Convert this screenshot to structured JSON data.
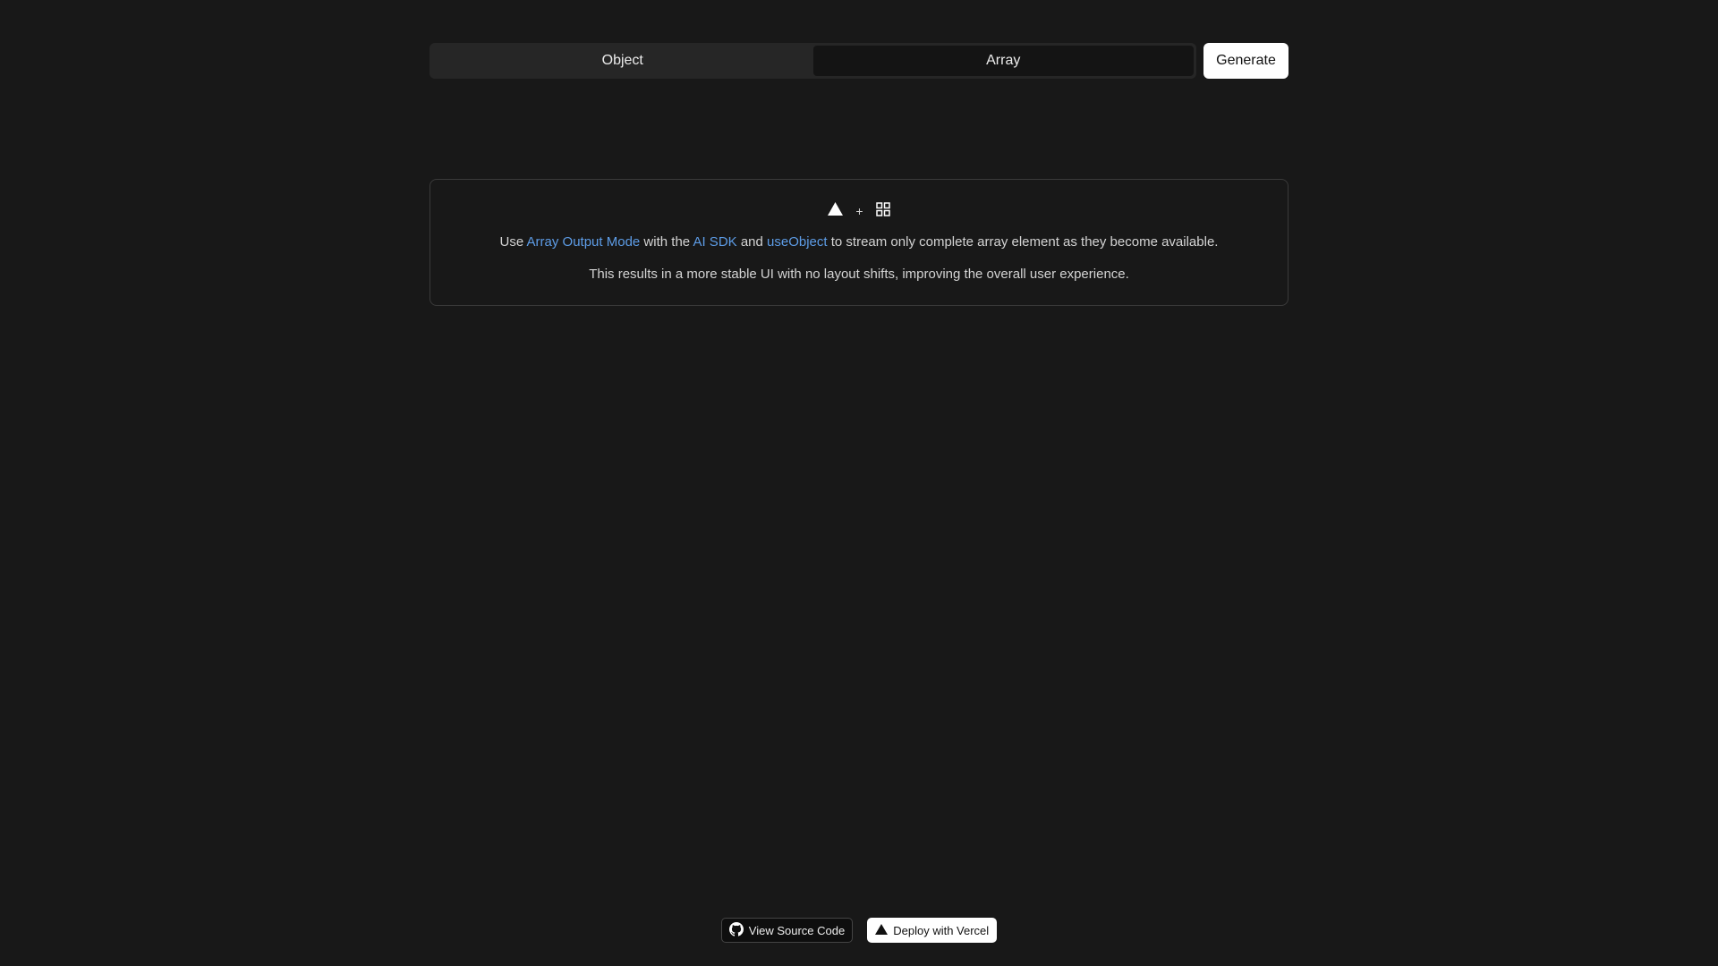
{
  "tabs": {
    "items": [
      {
        "label": "Object",
        "active": false
      },
      {
        "label": "Array",
        "active": true
      }
    ]
  },
  "toolbar": {
    "generate_label": "Generate"
  },
  "info": {
    "logos": [
      "vercel-triangle-icon",
      "plus",
      "grid-icon"
    ],
    "plus_label": "+",
    "line1": {
      "use": "Use ",
      "link_array_output": "Array Output Mode",
      "with_the": " with the ",
      "link_ai_sdk": "AI SDK",
      "and": " and ",
      "link_use_object": "useObject",
      "rest": " to stream only complete array element as they become available."
    },
    "line2": "This results in a more stable UI with no layout shifts, improving the overall user experience."
  },
  "footer": {
    "source_label": "View Source Code",
    "deploy_label": "Deploy with Vercel"
  },
  "colors": {
    "background": "#181818",
    "link": "#5d9ce6",
    "card_border": "#3a3a3a"
  }
}
